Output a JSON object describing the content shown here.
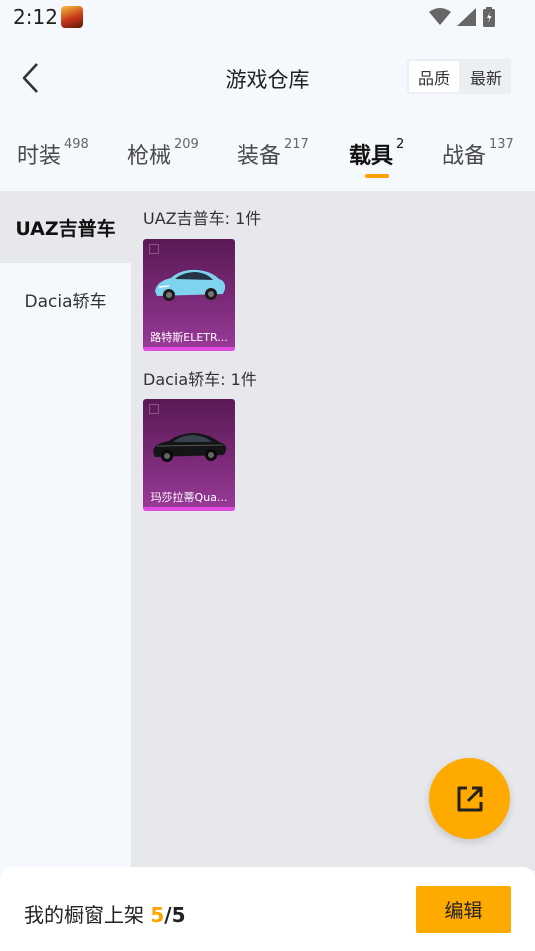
{
  "status_bar": {
    "time": "2:12",
    "icons": [
      "app-notification-icon",
      "wifi-icon",
      "signal-icon",
      "battery-icon"
    ]
  },
  "nav": {
    "title": "游戏仓库",
    "sort_options": [
      "品质",
      "最新"
    ],
    "active_sort": "品质"
  },
  "tabs": [
    {
      "label": "时装",
      "count": "498"
    },
    {
      "label": "枪械",
      "count": "209"
    },
    {
      "label": "装备",
      "count": "217"
    },
    {
      "label": "载具",
      "count": "2",
      "active": true
    },
    {
      "label": "战备",
      "count": "137"
    }
  ],
  "sidebar": {
    "items": [
      {
        "label": "UAZ吉普车",
        "active": true
      },
      {
        "label": "Dacia轿车"
      }
    ]
  },
  "groups": [
    {
      "title": "UAZ吉普车: 1件",
      "items": [
        {
          "name": "路特斯ELETR...",
          "icon": "light-blue-suv"
        }
      ]
    },
    {
      "title": "Dacia轿车: 1件",
      "items": [
        {
          "name": "玛莎拉蒂Qua...",
          "icon": "black-sedan"
        }
      ]
    }
  ],
  "fab": {
    "icon": "share-external-icon"
  },
  "bottom": {
    "shelf_label": "我的橱窗上架",
    "shelf_current": "5",
    "shelf_separator": "/",
    "shelf_total": "5",
    "edit_label": "编辑"
  },
  "colors": {
    "accent": "#ffaa00",
    "indicator": "#ff9f00",
    "card_bg": "#7b2a78",
    "card_stripe": "#e04be0"
  }
}
